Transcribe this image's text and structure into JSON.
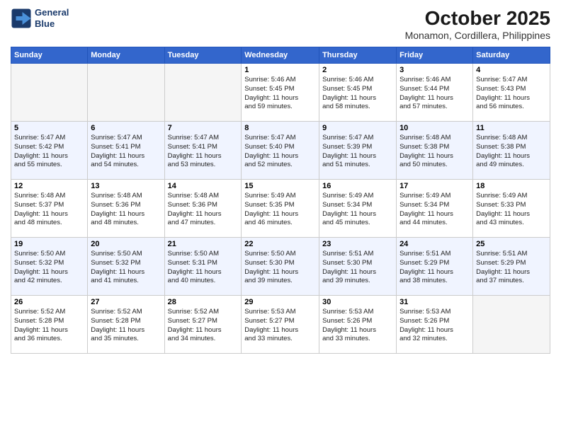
{
  "header": {
    "logo_line1": "General",
    "logo_line2": "Blue",
    "title": "October 2025",
    "subtitle": "Monamon, Cordillera, Philippines"
  },
  "weekdays": [
    "Sunday",
    "Monday",
    "Tuesday",
    "Wednesday",
    "Thursday",
    "Friday",
    "Saturday"
  ],
  "weeks": [
    [
      {
        "day": "",
        "info": ""
      },
      {
        "day": "",
        "info": ""
      },
      {
        "day": "",
        "info": ""
      },
      {
        "day": "1",
        "info": "Sunrise: 5:46 AM\nSunset: 5:45 PM\nDaylight: 11 hours\nand 59 minutes."
      },
      {
        "day": "2",
        "info": "Sunrise: 5:46 AM\nSunset: 5:45 PM\nDaylight: 11 hours\nand 58 minutes."
      },
      {
        "day": "3",
        "info": "Sunrise: 5:46 AM\nSunset: 5:44 PM\nDaylight: 11 hours\nand 57 minutes."
      },
      {
        "day": "4",
        "info": "Sunrise: 5:47 AM\nSunset: 5:43 PM\nDaylight: 11 hours\nand 56 minutes."
      }
    ],
    [
      {
        "day": "5",
        "info": "Sunrise: 5:47 AM\nSunset: 5:42 PM\nDaylight: 11 hours\nand 55 minutes."
      },
      {
        "day": "6",
        "info": "Sunrise: 5:47 AM\nSunset: 5:41 PM\nDaylight: 11 hours\nand 54 minutes."
      },
      {
        "day": "7",
        "info": "Sunrise: 5:47 AM\nSunset: 5:41 PM\nDaylight: 11 hours\nand 53 minutes."
      },
      {
        "day": "8",
        "info": "Sunrise: 5:47 AM\nSunset: 5:40 PM\nDaylight: 11 hours\nand 52 minutes."
      },
      {
        "day": "9",
        "info": "Sunrise: 5:47 AM\nSunset: 5:39 PM\nDaylight: 11 hours\nand 51 minutes."
      },
      {
        "day": "10",
        "info": "Sunrise: 5:48 AM\nSunset: 5:38 PM\nDaylight: 11 hours\nand 50 minutes."
      },
      {
        "day": "11",
        "info": "Sunrise: 5:48 AM\nSunset: 5:38 PM\nDaylight: 11 hours\nand 49 minutes."
      }
    ],
    [
      {
        "day": "12",
        "info": "Sunrise: 5:48 AM\nSunset: 5:37 PM\nDaylight: 11 hours\nand 48 minutes."
      },
      {
        "day": "13",
        "info": "Sunrise: 5:48 AM\nSunset: 5:36 PM\nDaylight: 11 hours\nand 48 minutes."
      },
      {
        "day": "14",
        "info": "Sunrise: 5:48 AM\nSunset: 5:36 PM\nDaylight: 11 hours\nand 47 minutes."
      },
      {
        "day": "15",
        "info": "Sunrise: 5:49 AM\nSunset: 5:35 PM\nDaylight: 11 hours\nand 46 minutes."
      },
      {
        "day": "16",
        "info": "Sunrise: 5:49 AM\nSunset: 5:34 PM\nDaylight: 11 hours\nand 45 minutes."
      },
      {
        "day": "17",
        "info": "Sunrise: 5:49 AM\nSunset: 5:34 PM\nDaylight: 11 hours\nand 44 minutes."
      },
      {
        "day": "18",
        "info": "Sunrise: 5:49 AM\nSunset: 5:33 PM\nDaylight: 11 hours\nand 43 minutes."
      }
    ],
    [
      {
        "day": "19",
        "info": "Sunrise: 5:50 AM\nSunset: 5:32 PM\nDaylight: 11 hours\nand 42 minutes."
      },
      {
        "day": "20",
        "info": "Sunrise: 5:50 AM\nSunset: 5:32 PM\nDaylight: 11 hours\nand 41 minutes."
      },
      {
        "day": "21",
        "info": "Sunrise: 5:50 AM\nSunset: 5:31 PM\nDaylight: 11 hours\nand 40 minutes."
      },
      {
        "day": "22",
        "info": "Sunrise: 5:50 AM\nSunset: 5:30 PM\nDaylight: 11 hours\nand 39 minutes."
      },
      {
        "day": "23",
        "info": "Sunrise: 5:51 AM\nSunset: 5:30 PM\nDaylight: 11 hours\nand 39 minutes."
      },
      {
        "day": "24",
        "info": "Sunrise: 5:51 AM\nSunset: 5:29 PM\nDaylight: 11 hours\nand 38 minutes."
      },
      {
        "day": "25",
        "info": "Sunrise: 5:51 AM\nSunset: 5:29 PM\nDaylight: 11 hours\nand 37 minutes."
      }
    ],
    [
      {
        "day": "26",
        "info": "Sunrise: 5:52 AM\nSunset: 5:28 PM\nDaylight: 11 hours\nand 36 minutes."
      },
      {
        "day": "27",
        "info": "Sunrise: 5:52 AM\nSunset: 5:28 PM\nDaylight: 11 hours\nand 35 minutes."
      },
      {
        "day": "28",
        "info": "Sunrise: 5:52 AM\nSunset: 5:27 PM\nDaylight: 11 hours\nand 34 minutes."
      },
      {
        "day": "29",
        "info": "Sunrise: 5:53 AM\nSunset: 5:27 PM\nDaylight: 11 hours\nand 33 minutes."
      },
      {
        "day": "30",
        "info": "Sunrise: 5:53 AM\nSunset: 5:26 PM\nDaylight: 11 hours\nand 33 minutes."
      },
      {
        "day": "31",
        "info": "Sunrise: 5:53 AM\nSunset: 5:26 PM\nDaylight: 11 hours\nand 32 minutes."
      },
      {
        "day": "",
        "info": ""
      }
    ]
  ]
}
